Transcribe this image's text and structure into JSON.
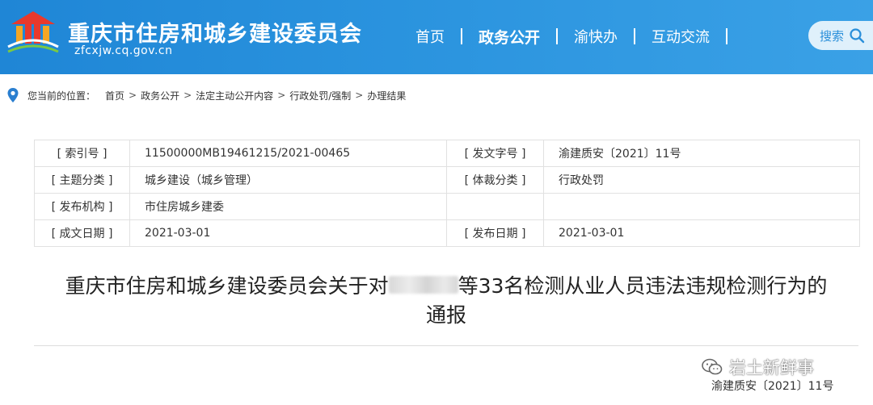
{
  "header": {
    "title": "重庆市住房和城乡建设委员会",
    "domain": "zfcxjw.cq.gov.cn",
    "nav": [
      {
        "label": "首页",
        "active": false
      },
      {
        "label": "政务公开",
        "active": true
      },
      {
        "label": "渝快办",
        "active": false
      },
      {
        "label": "互动交流",
        "active": false
      }
    ],
    "search_label": "搜索",
    "colors": {
      "bar": "#2a93de",
      "search_bg": "#dff0fb"
    }
  },
  "breadcrumb": {
    "prefix": "您当前的位置：",
    "items": [
      "首页",
      "政务公开",
      "法定主动公开内容",
      "行政处罚/强制",
      "办理结果"
    ],
    "separator": ">"
  },
  "info": {
    "index_label": "[ 索引号 ]",
    "index_value": "11500000MB19461215/2021-00465",
    "docno_label": "[ 发文字号 ]",
    "docno_value": "渝建质安〔2021〕11号",
    "topic_label": "[ 主题分类 ]",
    "topic_value": "城乡建设（城乡管理）",
    "genre_label": "[ 体裁分类 ]",
    "genre_value": "行政处罚",
    "org_label": "[ 发布机构 ]",
    "org_value": "市住房城乡建委",
    "created_label": "[ 成文日期 ]",
    "created_value": "2021-03-01",
    "published_label": "[ 发布日期 ]",
    "published_value": "2021-03-01"
  },
  "article": {
    "title_part1": "重庆市住房和城乡建设委员会关于对",
    "title_part2": "等33名检测从业人员违法违规检测行为的",
    "title_part3": "通报",
    "doc_number": "渝建质安〔2021〕11号"
  },
  "watermark": {
    "text": "岩土新鲜事",
    "icon": "wechat-icon"
  }
}
